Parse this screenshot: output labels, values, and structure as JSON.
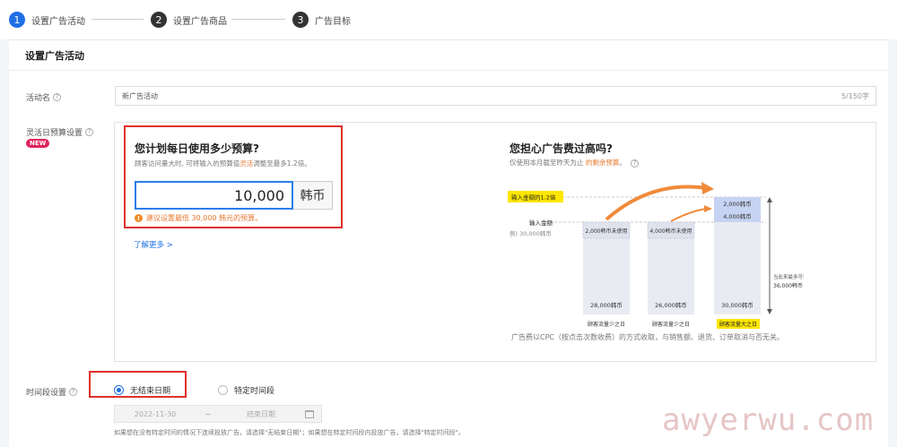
{
  "stepper": {
    "steps": [
      {
        "num": "1",
        "label": "设置广告活动"
      },
      {
        "num": "2",
        "label": "设置广告商品"
      },
      {
        "num": "3",
        "label": "广告目标"
      }
    ]
  },
  "card": {
    "title": "设置广告活动"
  },
  "campaign_name": {
    "label": "活动名",
    "value": "新广告活动",
    "count": "5/150字"
  },
  "budget": {
    "label": "灵活日预算设置",
    "badge": "NEW",
    "question": "您计划每日使用多少预算?",
    "sub_prefix": "顾客访问量大时, 可将输入的预算值",
    "sub_highlight": "灵活",
    "sub_suffix": "调整至最多1.2倍。",
    "amount": "10,000",
    "unit": "韩币",
    "warning": "建议设置最低 30,000 韩元的预算。",
    "more_link": "了解更多 >"
  },
  "info": {
    "question": "您担心广告费过高吗?",
    "sub_prefix": "仅使用本月截至昨天为止 ",
    "sub_highlight": "的剩余预算",
    "sub_suffix": "。",
    "chart_labels": {
      "input_x": "输入金额的1.2倍",
      "input": "输入金额",
      "example": "例) 30,000韩币",
      "bar1_unused": "2,000韩币未使用",
      "bar2_unused": "4,000韩币未使用",
      "bar3_top": "2,000韩币",
      "bar3_mid": "4,000韩币",
      "bar1_value": "28,000韩币",
      "bar2_value": "26,000韩币",
      "bar3_value": "30,000韩币",
      "cap1": "顾客流量少之日",
      "cap2": "顾客流量少之日",
      "cap3": "顾客流量大之日",
      "side_line1": "当此来最多可使用",
      "side_line2": "36,000韩币"
    },
    "bottom_note": "广告费以CPC（按点击次数收费）的方式收取，与销售额、退货、订单取消与否无关。"
  },
  "time_range": {
    "label": "时间段设置",
    "option1": "无结束日期",
    "option2": "特定时间段",
    "start_date": "2022-11-30",
    "tilde": "~",
    "end_placeholder": "结束日期",
    "hint": "如果想在没有特定时间的情况下连续投放广告，请选择\"无结束日期\"；如果想在特定时间段内投放广告，请选择\"特定时间段\"。"
  },
  "watermark": "awyerwu.com",
  "colors": {
    "accent": "#1f6fe5",
    "warning": "#e8772e",
    "red_box": "#e0302b",
    "highlight_yellow": "#ffe600"
  }
}
